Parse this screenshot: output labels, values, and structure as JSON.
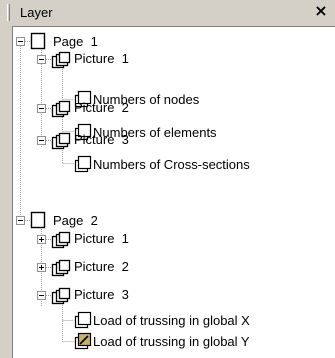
{
  "panel": {
    "title": "Layer",
    "close_label": "×"
  },
  "tree": [
    {
      "label": "Page  1",
      "icon": "page-icon",
      "expander": "minus"
    },
    {
      "label": "Picture  1",
      "icon": "picture-icon",
      "expander": "minus"
    },
    {
      "label": "Numbers of nodes",
      "icon": "layer-icon"
    },
    {
      "label": "Picture  2",
      "icon": "picture-icon",
      "expander": "minus"
    },
    {
      "label": "Numbers of elements",
      "icon": "layer-icon"
    },
    {
      "label": "Picture  3",
      "icon": "picture-icon",
      "expander": "minus"
    },
    {
      "label": "Numbers of Cross-sections",
      "icon": "layer-icon"
    },
    {
      "label": "Page  2",
      "icon": "page-icon",
      "expander": "minus"
    },
    {
      "label": "Picture  1",
      "icon": "picture-icon",
      "expander": "plus"
    },
    {
      "label": "Picture  2",
      "icon": "picture-icon",
      "expander": "plus"
    },
    {
      "label": "Picture  3",
      "icon": "picture-icon",
      "expander": "minus"
    },
    {
      "label": "Load of trussing in global X",
      "icon": "layer-icon"
    },
    {
      "label": "Load of trussing in global Y",
      "icon": "edit-layer-icon"
    }
  ],
  "colors": {
    "panel_bg": "#d4d0c8",
    "tree_bg": "#ffffff",
    "line": "#a0a0a0",
    "edit_icon_fill": "#c9b16a"
  }
}
